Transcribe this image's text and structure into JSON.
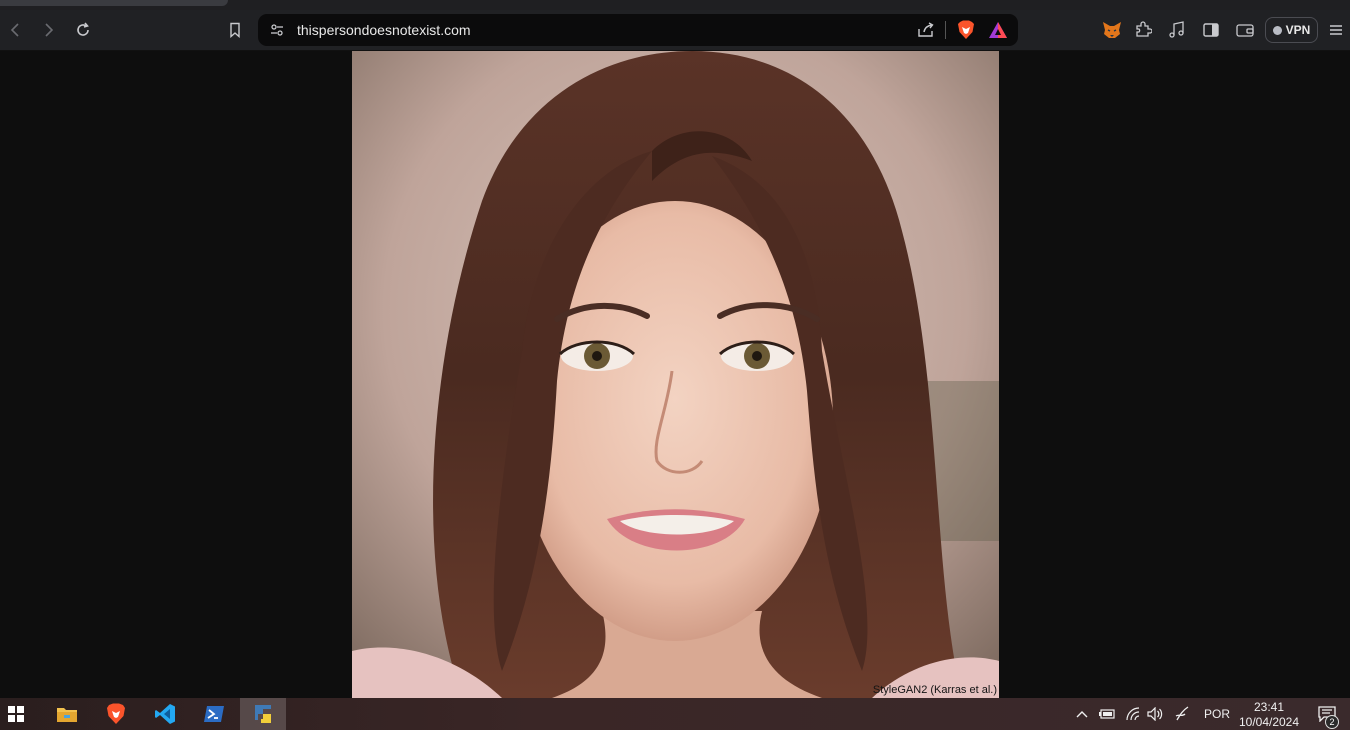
{
  "browser": {
    "url": "thispersondoesnotexist.com",
    "vpn_label": "VPN"
  },
  "page": {
    "image_alt": "Portrait generated by StyleGAN2",
    "credit": "StyleGAN2 (Karras et al.)"
  },
  "taskbar": {
    "language": "POR",
    "time": "23:41",
    "date": "10/04/2024",
    "notification_count": "2"
  },
  "icons": {
    "back": "back-arrow-icon",
    "forward": "forward-arrow-icon",
    "reload": "reload-icon",
    "bookmark": "bookmark-icon",
    "site_settings": "site-settings-icon",
    "share": "share-icon",
    "brave_shields": "brave-lion-icon",
    "brave_rewards": "brave-rewards-triangle-icon",
    "metamask": "fox-icon",
    "extensions": "puzzle-icon",
    "media": "music-note-icon",
    "sidebar": "sidebar-icon",
    "wallet": "wallet-icon",
    "menu": "hamburger-menu-icon"
  },
  "colors": {
    "toolbar_bg": "#202124",
    "urlbar_bg": "#0b0b0c",
    "brave_orange": "#fb542b",
    "taskbar_bg": "#3a2626"
  }
}
